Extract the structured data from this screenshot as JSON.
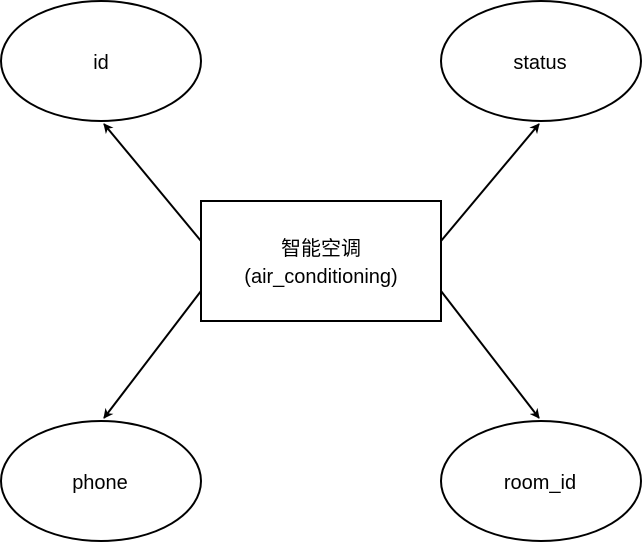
{
  "entity": {
    "line1": "智能空调",
    "line2": "(air_conditioning)"
  },
  "attributes": {
    "id": "id",
    "status": "status",
    "phone": "phone",
    "room_id": "room_id"
  },
  "colors": {
    "stroke": "#000000",
    "fill": "#ffffff",
    "background": "#ffffff"
  }
}
